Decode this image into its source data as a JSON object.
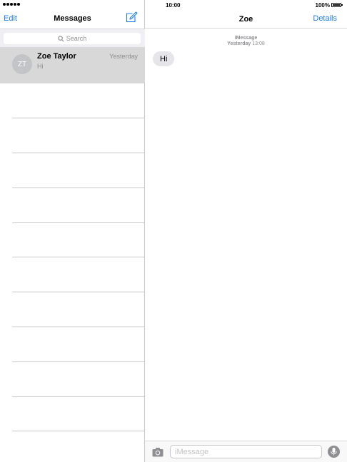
{
  "status": {
    "time": "10:00",
    "battery_text": "100%"
  },
  "list": {
    "edit_label": "Edit",
    "title": "Messages",
    "search_placeholder": "Search",
    "conversations": [
      {
        "initials": "ZT",
        "name": "Zoe Taylor",
        "time": "Yesterday",
        "preview": "Hi"
      }
    ]
  },
  "chat": {
    "title": "Zoe",
    "details_label": "Details",
    "service": "iMessage",
    "day": "Yesterday",
    "time": "13:08",
    "messages": [
      {
        "text": "Hi",
        "direction": "incoming"
      }
    ],
    "input_placeholder": "iMessage"
  },
  "colors": {
    "accent": "#1a7cf5",
    "selected_row": "#d8d8d8",
    "bubble_incoming": "#e5e5ea"
  }
}
